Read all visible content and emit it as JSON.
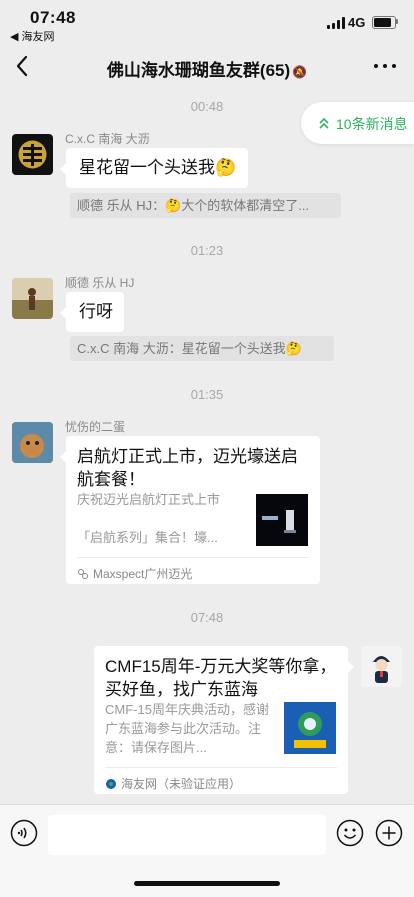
{
  "status": {
    "time": "07:48",
    "back_app": "◀ 海友网",
    "network": "4G"
  },
  "nav": {
    "title": "佛山海水珊瑚鱼友群(65)",
    "mute": "🔕"
  },
  "new_messages": {
    "label": "10条新消息"
  },
  "messages": [
    {
      "time": "00:48",
      "sender": "C.x.C 南海 大沥",
      "text": "星花留一个头送我🤔",
      "quote": "顺德 乐从 HJ：🤔大个的软体都清空了..."
    },
    {
      "time": "01:23",
      "sender": "顺德 乐从 HJ",
      "text": "行呀",
      "quote": "C.x.C 南海 大沥：星花留一个头送我🤔"
    },
    {
      "time": "01:35",
      "sender": "忧伤的二蛋",
      "card": {
        "title": "启航灯正式上市，迈光壕送启航套餐！",
        "desc": "庆祝迈光启航灯正式上市\n\n「启航系列」集合！壕...",
        "source": "Maxspect广州迈光"
      }
    },
    {
      "time": "07:48",
      "card": {
        "title": "CMF15周年-万元大奖等你拿，买好鱼，找广东蓝海",
        "desc": "CMF-15周年庆典活动，感谢广东蓝海参与此次活动。注意：请保存图片...",
        "source": "海友网（未验证应用）"
      }
    }
  ],
  "colors": {
    "accent_green": "#2fb160",
    "background": "#ededed"
  }
}
